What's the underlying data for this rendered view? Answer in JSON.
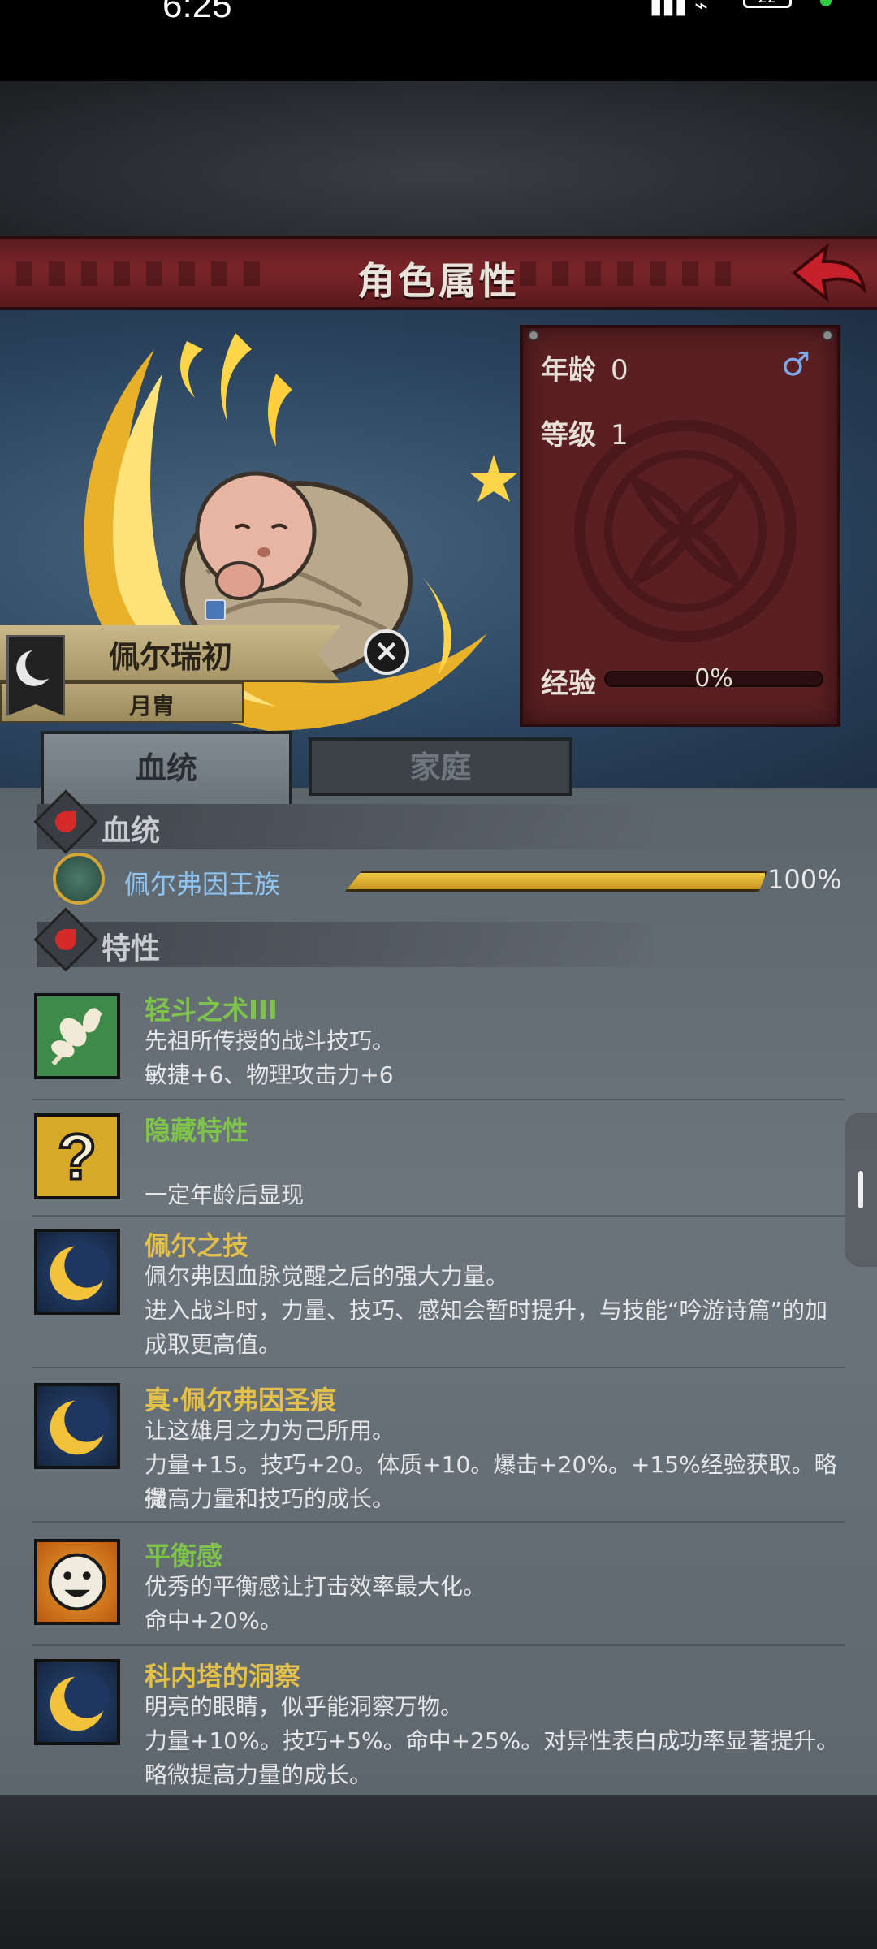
{
  "status": {
    "time": "6:25",
    "battery": "22"
  },
  "header": {
    "title": "角色属性"
  },
  "stats": {
    "age_label": "年龄",
    "age_value": "0",
    "level_label": "等级",
    "level_value": "1",
    "exp_label": "经验",
    "exp_value": "0%"
  },
  "character": {
    "name": "佩尔瑞初",
    "subtitle": "月胄"
  },
  "tabs": [
    {
      "label": "血统"
    },
    {
      "label": "家庭"
    }
  ],
  "bloodline": {
    "section_title": "血统",
    "name": "佩尔弗因王族",
    "percent": "100%",
    "fill": 1.0
  },
  "traits_section": {
    "title": "特性"
  },
  "traits": [
    {
      "name": "轻斗之术III",
      "lines": [
        "先祖所传授的战斗技巧。",
        "敏捷+6、物理攻击力+6"
      ],
      "icon": "leaf-icon",
      "color": "#7ec44a"
    },
    {
      "name": "隐藏特性",
      "lines": [
        "",
        "一定年龄后显现"
      ],
      "icon": "question-icon",
      "color": "#7ec44a"
    },
    {
      "name": "佩尔之技",
      "lines": [
        "佩尔弗因血脉觉醒之后的强大力量。",
        "进入战斗时，力量、技巧、感知会暂时提升，与技能“吟游诗篇”的加",
        "成取更高值。"
      ],
      "icon": "moon-icon",
      "color": "#e2c04a"
    },
    {
      "name": "真·佩尔弗因圣痕",
      "lines": [
        "让这雄月之力为己所用。",
        "力量+15。技巧+20。体质+10。爆击+20%。+15%经验获取。略微",
        "提高力量和技巧的成长。"
      ],
      "icon": "moon-icon",
      "color": "#e2c04a"
    },
    {
      "name": "平衡感",
      "lines": [
        "优秀的平衡感让打击效率最大化。",
        "命中+20%。"
      ],
      "icon": "smile-icon",
      "color": "#7ec44a"
    },
    {
      "name": "科内塔的洞察",
      "lines": [
        "明亮的眼睛，似乎能洞察万物。",
        "力量+10%。技巧+5%。命中+25%。对异性表白成功率显著提升。",
        "略微提高力量的成长。"
      ],
      "icon": "moon-icon",
      "color": "#e2c04a"
    }
  ]
}
